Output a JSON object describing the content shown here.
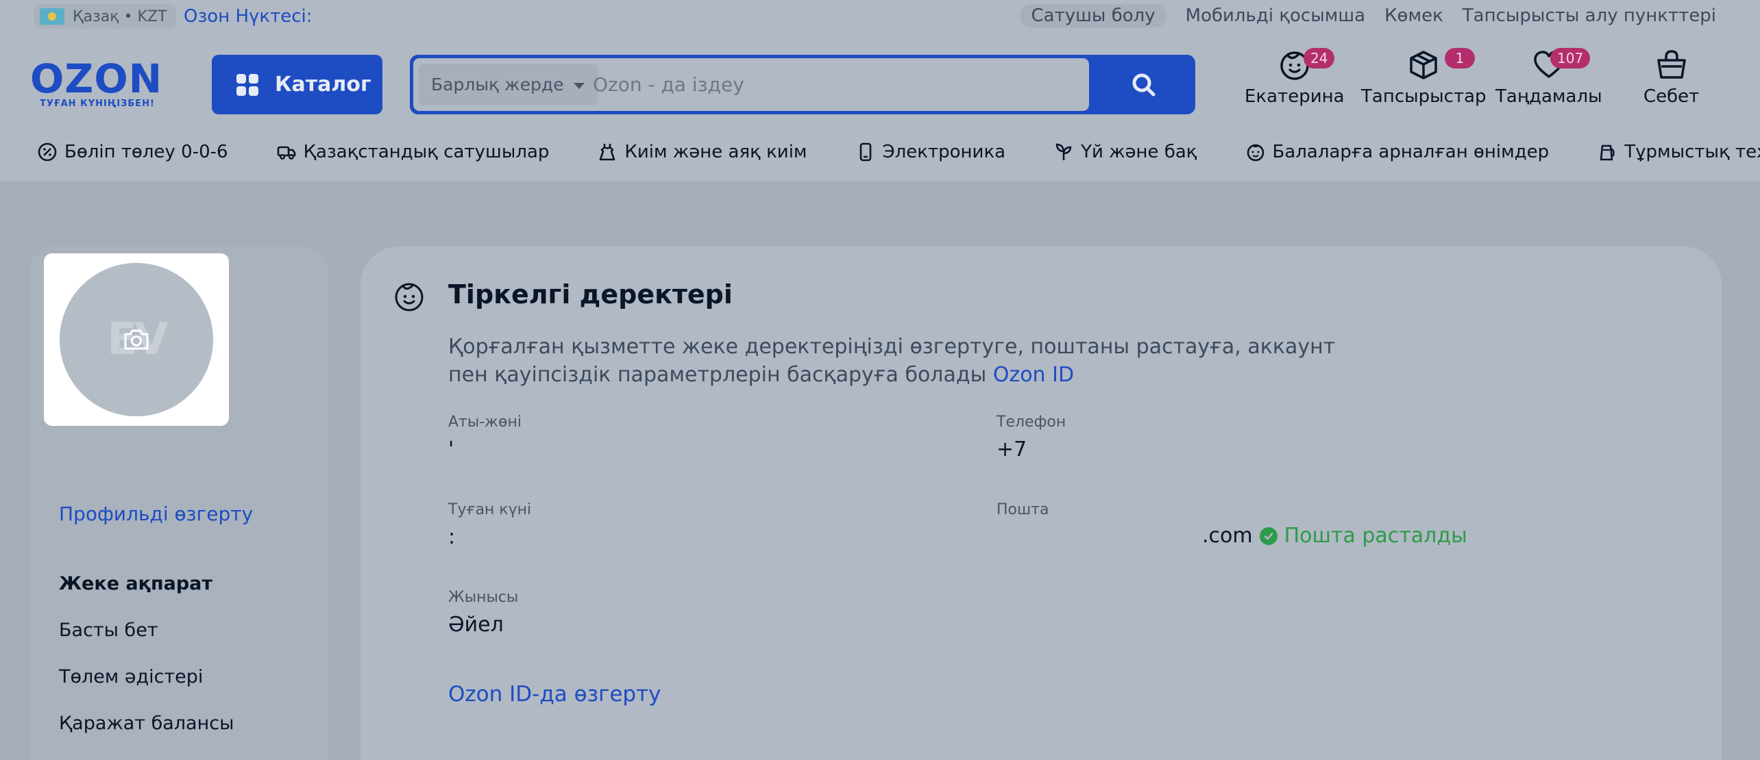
{
  "topbar": {
    "lang": "Қазақ • KZT",
    "point": "Озон Нүктесі:",
    "links": [
      "Сатушы болу",
      "Мобильді қосымша",
      "Көмек",
      "Тапсырысты алу пункттері"
    ]
  },
  "header": {
    "logo": "OZON",
    "logo_sub": "ТУҒАН КҮНІҢІЗБЕН!",
    "catalog_label": "Каталог",
    "search_scope": "Барлық жерде",
    "search_placeholder": "Ozon - да іздеу",
    "actions": [
      {
        "label": "Екатерина",
        "badge": "24",
        "icon": "profile-face-icon"
      },
      {
        "label": "Тапсырыстар",
        "badge": "1",
        "icon": "box-icon"
      },
      {
        "label": "Таңдамалы",
        "badge": "107",
        "icon": "heart-icon"
      },
      {
        "label": "Себет",
        "badge": null,
        "icon": "cart-icon"
      }
    ]
  },
  "categories": [
    "Бөліп төлеу 0-0-6",
    "Қазақстандық сатушылар",
    "Киім және аяқ киім",
    "Электроника",
    "Үй және бақ",
    "Балаларға арналған өнімдер",
    "Тұрмыстық техника"
  ],
  "sidebar": {
    "avatar_initials": "ЕV",
    "edit_profile": "Профильді өзгерту",
    "menu": [
      "Жеке ақпарат",
      "Басты бет",
      "Төлем әдістері",
      "Қаражат балансы"
    ]
  },
  "account": {
    "title": "Тіркелгі деректері",
    "description": "Қорғалған қызметте жеке деректеріңізді өзгертуге, поштаны растауға, аккаунт пен қауіпсіздік параметрлерін басқаруға болады",
    "description_link": "Ozon ID",
    "fullname_label": "Аты-жөні",
    "fullname_value": "'",
    "phone_label": "Телефон",
    "phone_value": "+7",
    "birthday_label": "Туған күні",
    "birthday_value": ":",
    "email_label": "Пошта",
    "email_value": ".com",
    "email_verified": "Пошта расталды",
    "gender_label": "Жынысы",
    "gender_value": "Әйел",
    "edit_in_ozon_id": "Ozon ID-да өзгерту"
  },
  "colors": {
    "brand_blue": "#1e4cc2",
    "badge_magenta": "#b42d6c",
    "verified_green": "#2d9b48"
  }
}
